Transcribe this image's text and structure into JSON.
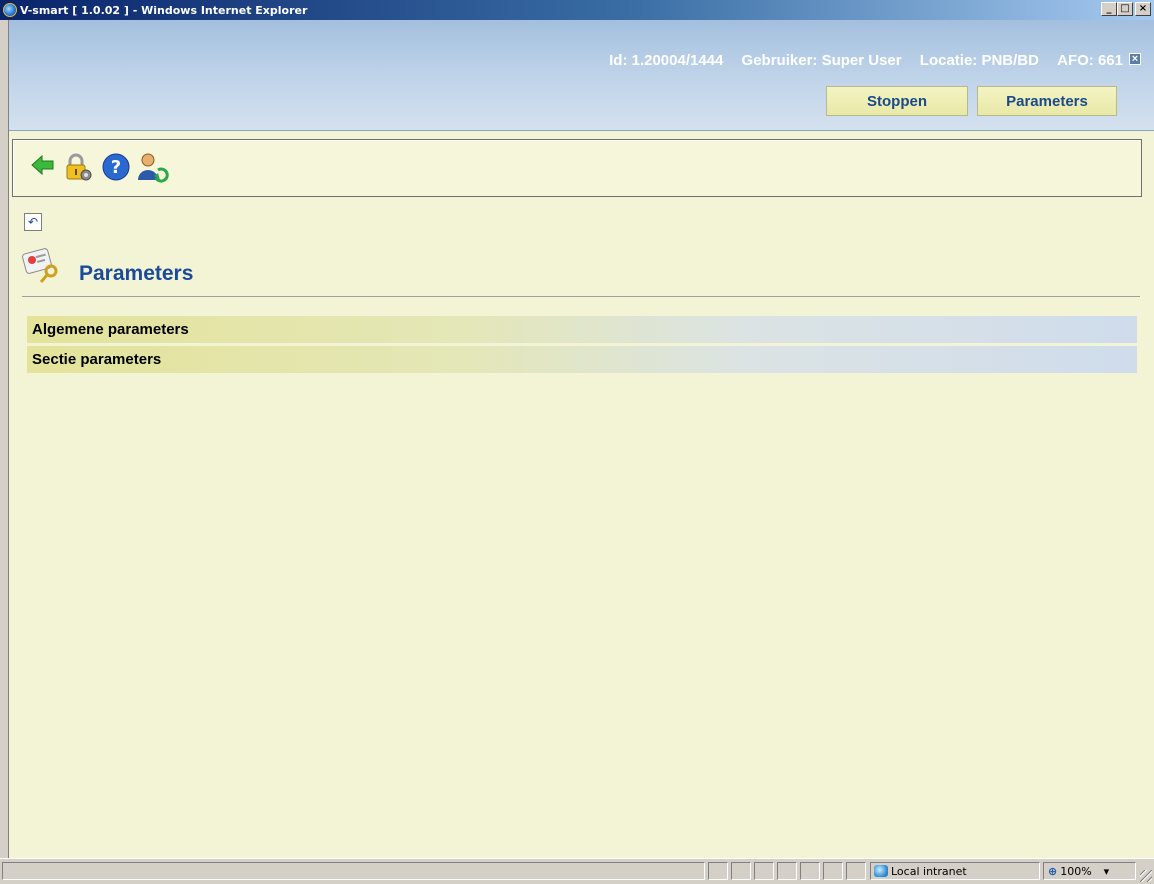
{
  "window": {
    "title": "V-smart [ 1.0.02 ] - Windows Internet Explorer",
    "minimize": "_",
    "maximize": "□",
    "close": "×"
  },
  "header": {
    "id": "Id: 1.20004/1444",
    "user": "Gebruiker: Super User",
    "location": "Locatie: PNB/BD",
    "afo": "AFO: 661",
    "close_symbol": "×",
    "stop_label": "Stoppen",
    "parameters_label": "Parameters"
  },
  "toolbar": {
    "icons": [
      "back-arrow-icon",
      "lock-settings-icon",
      "help-icon",
      "user-refresh-icon"
    ]
  },
  "page": {
    "undo_symbol": "↶",
    "title": "Parameters",
    "items": [
      {
        "label": "Algemene parameters"
      },
      {
        "label": "Sectie parameters"
      }
    ]
  },
  "statusbar": {
    "zone": "Local intranet",
    "zoom": "100%",
    "zoom_arrow": "▾"
  },
  "colors": {
    "accent": "#1a4a9a",
    "background": "#f3f3d6"
  }
}
